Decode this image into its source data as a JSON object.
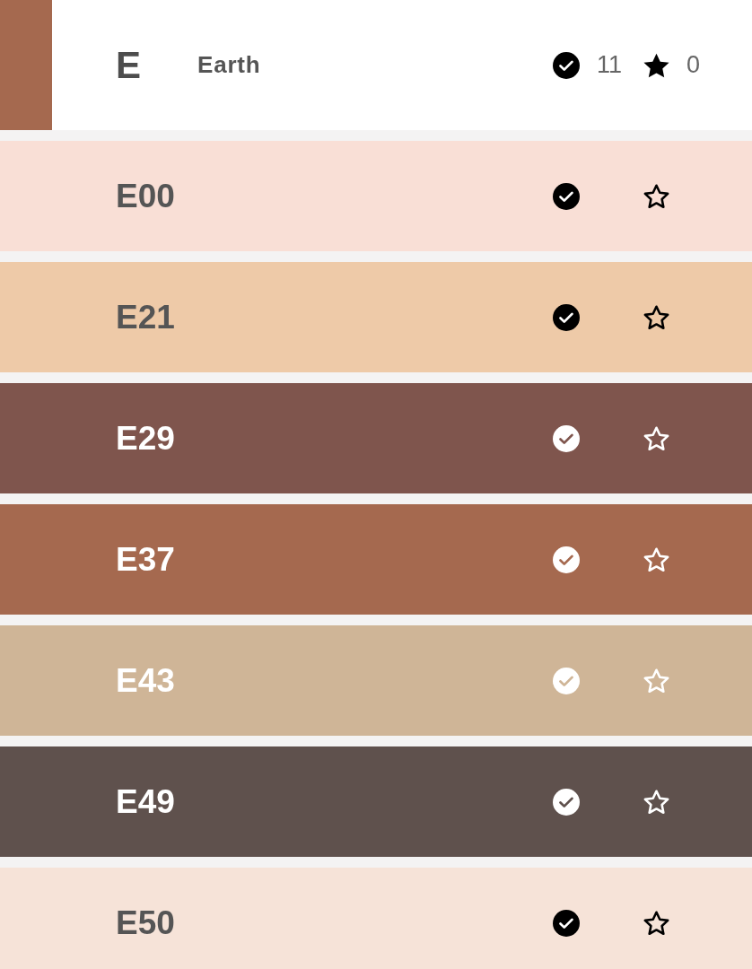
{
  "header": {
    "color": "#a5694f",
    "letter": "E",
    "name": "Earth",
    "owned_count": "11",
    "favorite_count": "0"
  },
  "swatches": [
    {
      "code": "E00",
      "color": "#f9dfd6",
      "owned": true,
      "favorite": false
    },
    {
      "code": "E21",
      "color": "#eecaa8",
      "owned": true,
      "favorite": false
    },
    {
      "code": "E29",
      "color": "#7f554d",
      "owned": true,
      "favorite": false
    },
    {
      "code": "E37",
      "color": "#a5694f",
      "owned": true,
      "favorite": false
    },
    {
      "code": "E43",
      "color": "#cfb597",
      "owned": true,
      "favorite": false
    },
    {
      "code": "E49",
      "color": "#5f514d",
      "owned": true,
      "favorite": false
    },
    {
      "code": "E50",
      "color": "#f6e3d8",
      "owned": true,
      "favorite": false
    }
  ]
}
